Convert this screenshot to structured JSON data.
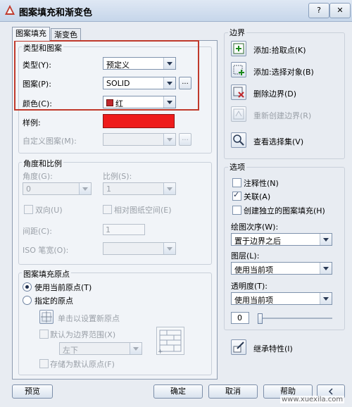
{
  "window": {
    "title": "图案填充和渐变色",
    "help_btn": "?",
    "close_btn": "✕"
  },
  "tabs": [
    "图案填充",
    "渐变色"
  ],
  "type_group": {
    "title": "类型和图案",
    "type_label": "类型(Y):",
    "type_value": "预定义",
    "pattern_label": "图案(P):",
    "pattern_value": "SOLID",
    "browse_btn": "...",
    "color_label": "颜色(C):",
    "color_value": "红",
    "swatch_label": "样例:",
    "custom_label": "自定义图案(M):",
    "custom_browse_btn": "..."
  },
  "angle_group": {
    "title": "角度和比例",
    "angle_label": "角度(G):",
    "angle_value": "0",
    "scale_label": "比例(S):",
    "scale_value": "1",
    "double_label": "双向(U)",
    "relative_label": "相对图纸空间(E)",
    "spacing_label": "间距(C):",
    "spacing_value": "1",
    "iso_label": "ISO 笔宽(O):"
  },
  "origin_group": {
    "title": "图案填充原点",
    "use_current_label": "使用当前原点(T)",
    "specified_label": "指定的原点",
    "click_set_label": "单击以设置新原点",
    "default_extent_label": "默认为边界范围(X)",
    "position_value": "左下",
    "store_default_label": "存储为默认原点(F)"
  },
  "boundary_group": {
    "title": "边界",
    "add_pick_label": "添加:拾取点(K)",
    "add_select_label": "添加:选择对象(B)",
    "remove_label": "删除边界(D)",
    "recreate_label": "重新创建边界(R)",
    "view_label": "查看选择集(V)"
  },
  "options_group": {
    "title": "选项",
    "annotative_label": "注释性(N)",
    "associative_label": "关联(A)",
    "independent_label": "创建独立的图案填充(H)",
    "draw_order_label": "绘图次序(W):",
    "draw_order_value": "置于边界之后",
    "layer_label": "图层(L):",
    "layer_value": "使用当前项",
    "transparency_label": "透明度(T):",
    "transparency_value": "使用当前项",
    "transparency_number": "0",
    "inherit_label": "继承特性(I)"
  },
  "footer": {
    "preview_btn": "预览",
    "ok_btn": "确定",
    "cancel_btn": "取消",
    "help_btn": "帮助",
    "watermark": "www.xuexila.com"
  },
  "colors": {
    "selected_swatch": "#EE1C1C",
    "highlight_frame": "#C0392B"
  }
}
